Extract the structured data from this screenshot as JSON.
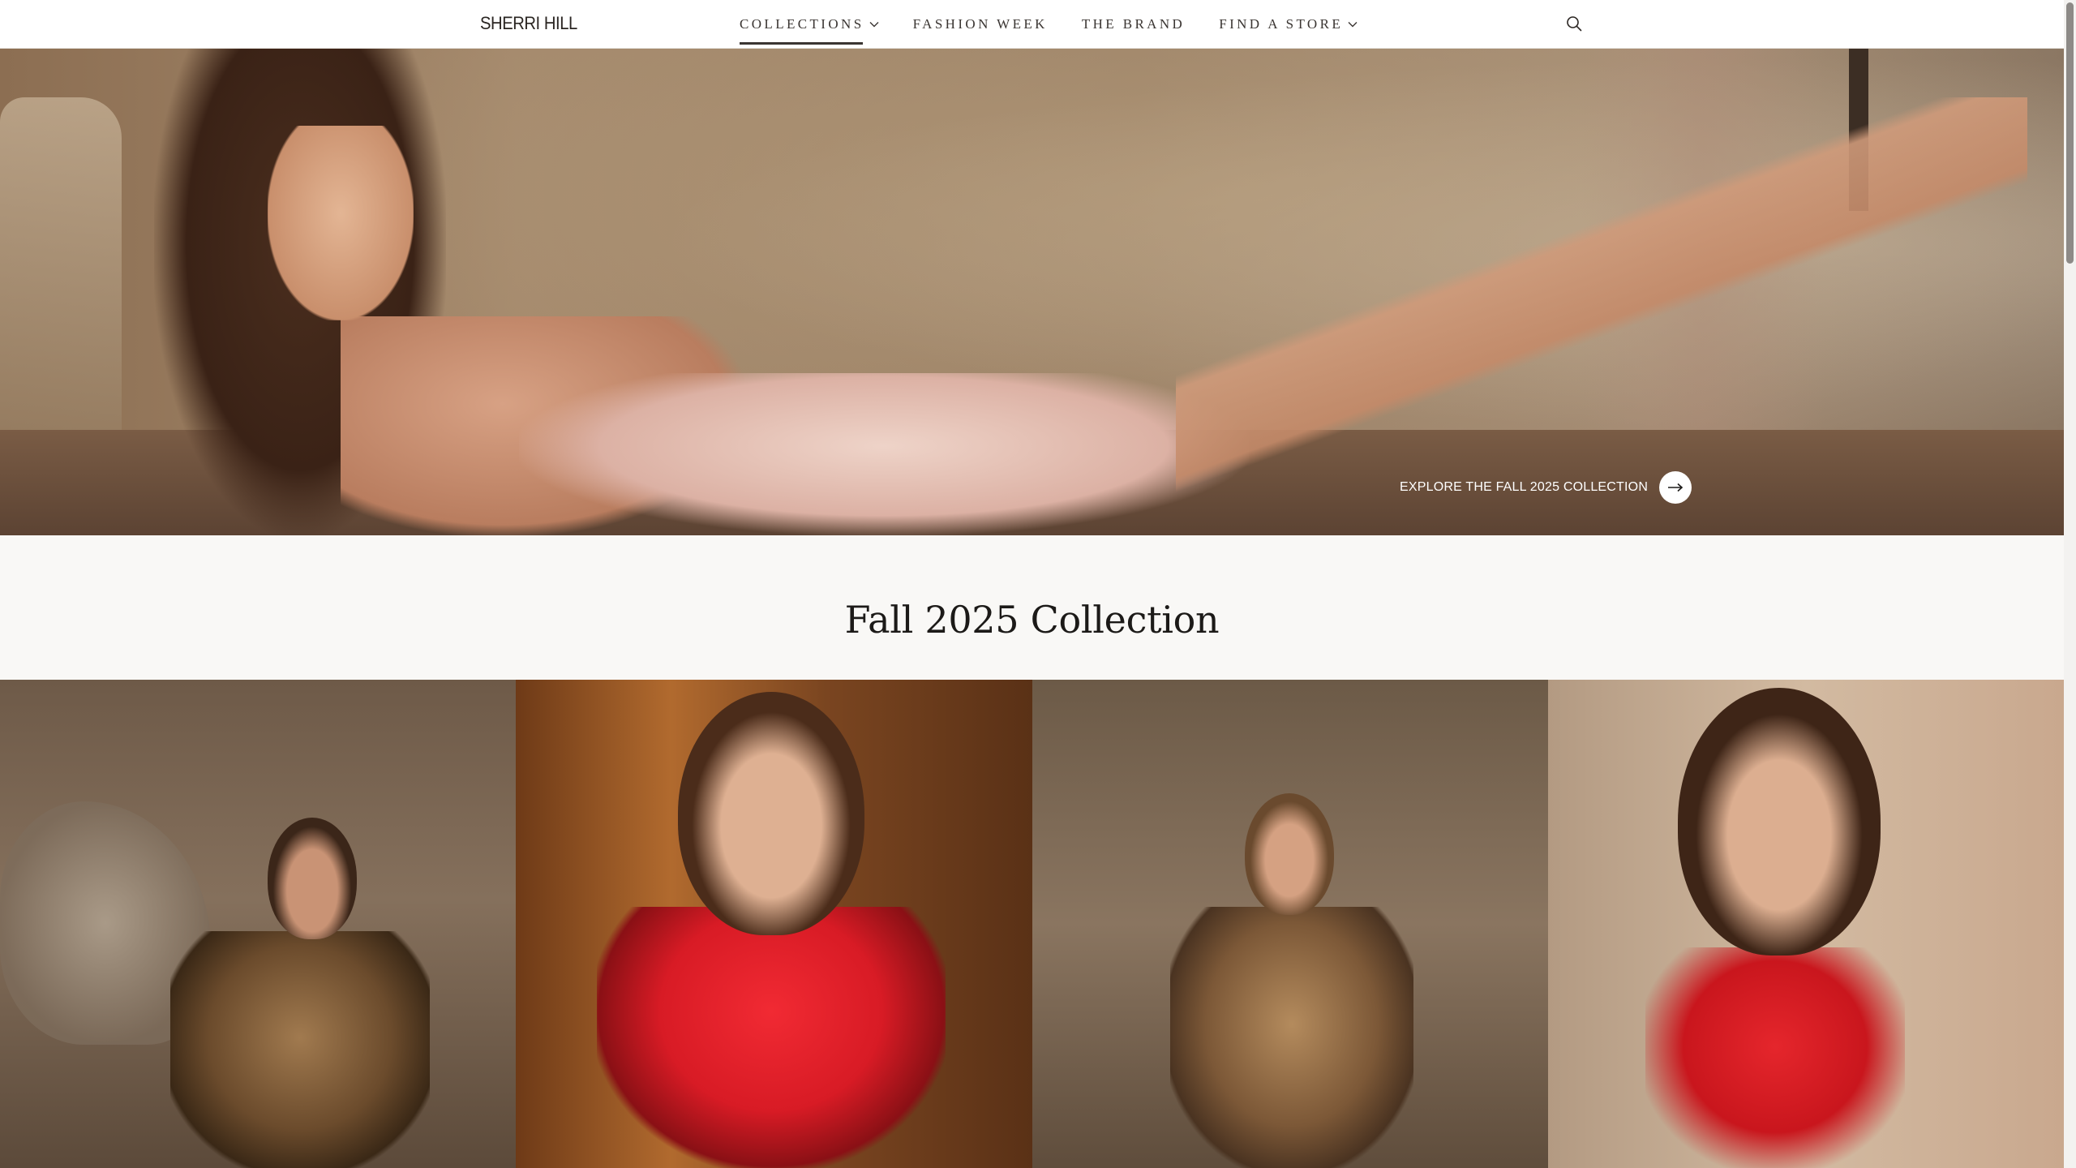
{
  "brand": {
    "logo_text": "SHERRI HILL"
  },
  "nav": {
    "items": [
      {
        "label": "COLLECTIONS",
        "has_dropdown": true,
        "active": true
      },
      {
        "label": "FASHION WEEK",
        "has_dropdown": false,
        "active": false
      },
      {
        "label": "THE BRAND",
        "has_dropdown": false,
        "active": false
      },
      {
        "label": "FIND A STORE",
        "has_dropdown": true,
        "active": false
      }
    ],
    "search_icon": "search-icon"
  },
  "hero": {
    "cta_label": "EXPLORE THE FALL 2025 COLLECTION",
    "cta_icon": "arrow-right-icon"
  },
  "collection": {
    "title": "Fall 2025 Collection"
  },
  "colors": {
    "text_dark": "#1c1a18",
    "section_bg": "#f9f8f6",
    "accent_red": "#d81b25"
  }
}
